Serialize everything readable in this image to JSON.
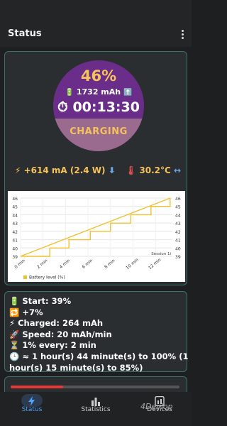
{
  "header": {
    "title": "Status"
  },
  "gauge": {
    "percent": "46%",
    "capacity": "1732 mAh",
    "timer": "00:13:30",
    "state": "CHARGING",
    "level": 0.46
  },
  "live": {
    "current": "+614 mA (2.4 W)",
    "temperature": "30.2°C"
  },
  "chart_data": {
    "type": "line",
    "x_ticks": [
      "0 min",
      "2 min",
      "4 min",
      "6 min",
      "8 min",
      "10 min",
      "12 min"
    ],
    "y_ticks": [
      "39",
      "40",
      "41",
      "42",
      "43",
      "44",
      "45",
      "46"
    ],
    "ylim": [
      39,
      46
    ],
    "xlim": [
      0,
      13.5
    ],
    "series": [
      {
        "name": "Battery level (%)",
        "x": [
          0,
          2.6,
          2.6,
          4.3,
          4.3,
          6.2,
          6.2,
          8.0,
          8.0,
          9.8,
          9.8,
          11.6,
          11.6,
          13.3,
          13.3
        ],
        "y": [
          39,
          39,
          40,
          40,
          41,
          41,
          42,
          42,
          43,
          43,
          44,
          44,
          45,
          45,
          46
        ]
      },
      {
        "name": "",
        "x": [
          0,
          13.3
        ],
        "y": [
          39,
          46
        ]
      }
    ],
    "annotation": "Session 1i",
    "legend": "Battery level (%)",
    "colors": {
      "line": "#f0c030"
    }
  },
  "info": {
    "start": "Start: 39%",
    "gain": "+7%",
    "charged": "Charged: 264 mAh",
    "speed": "Speed: 20 mAh/min",
    "rate": "1% every: 2 min",
    "eta1": "≈ 1 hour(s) 44 minute(s) to 100% (1",
    "eta2": "hour(s) 15 minute(s) to 85%)"
  },
  "nav": {
    "status": "Status",
    "statistics": "Statistics",
    "last": "Devices"
  },
  "watermark": "4Devlop"
}
